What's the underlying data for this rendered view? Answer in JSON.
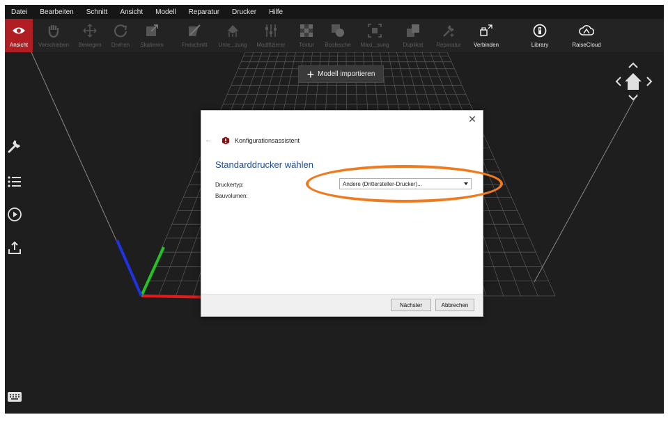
{
  "menubar": {
    "items": [
      "Datei",
      "Bearbeiten",
      "Schnitt",
      "Ansicht",
      "Modell",
      "Reparatur",
      "Drucker",
      "Hilfe"
    ]
  },
  "toolbar": {
    "tools": [
      {
        "label": "Ansicht",
        "icon": "eye-icon",
        "state": "active"
      },
      {
        "label": "Verschieben",
        "icon": "hand-icon",
        "state": "disabled"
      },
      {
        "label": "Bewegen",
        "icon": "move-icon",
        "state": "disabled"
      },
      {
        "label": "Drehen",
        "icon": "rotate-icon",
        "state": "disabled"
      },
      {
        "label": "Skalieren",
        "icon": "scale-icon",
        "state": "disabled"
      },
      {
        "label": "Freischnitt",
        "icon": "cut-icon",
        "state": "disabled"
      },
      {
        "label": "Unte...zung",
        "icon": "support-icon",
        "state": "disabled"
      },
      {
        "label": "Modifizierer",
        "icon": "modifier-icon",
        "state": "disabled"
      },
      {
        "label": "Textur",
        "icon": "texture-icon",
        "state": "disabled"
      },
      {
        "label": "Boolesche",
        "icon": "boolean-icon",
        "state": "disabled"
      },
      {
        "label": "Maxi...sung",
        "icon": "maximize-icon",
        "state": "disabled"
      },
      {
        "label": "Duplikat",
        "icon": "duplicate-icon",
        "state": "disabled"
      },
      {
        "label": "Reparatur",
        "icon": "repair-icon",
        "state": "disabled"
      },
      {
        "label": "Verbinden",
        "icon": "connect-icon",
        "state": "enabled"
      },
      {
        "label": "Library",
        "icon": "library-icon",
        "state": "enabled"
      },
      {
        "label": "RaiseCloud",
        "icon": "cloud-icon",
        "state": "enabled"
      }
    ]
  },
  "viewport": {
    "import_label": "Modell importieren"
  },
  "dialog": {
    "title": "Konfigurationsassistent",
    "heading": "Standarddrucker wählen",
    "printer_type_label": "Druckertyp:",
    "build_volume_label": "Bauvolumen:",
    "printer_type_value": "Andere (Drittersteller-Drucker)...",
    "next_label": "Nächster",
    "cancel_label": "Abbrechen",
    "close_glyph": "✕",
    "back_glyph": "←"
  },
  "colors": {
    "accent": "#b01e23",
    "highlight": "#f07a1e",
    "heading_blue": "#1e4b8f"
  }
}
